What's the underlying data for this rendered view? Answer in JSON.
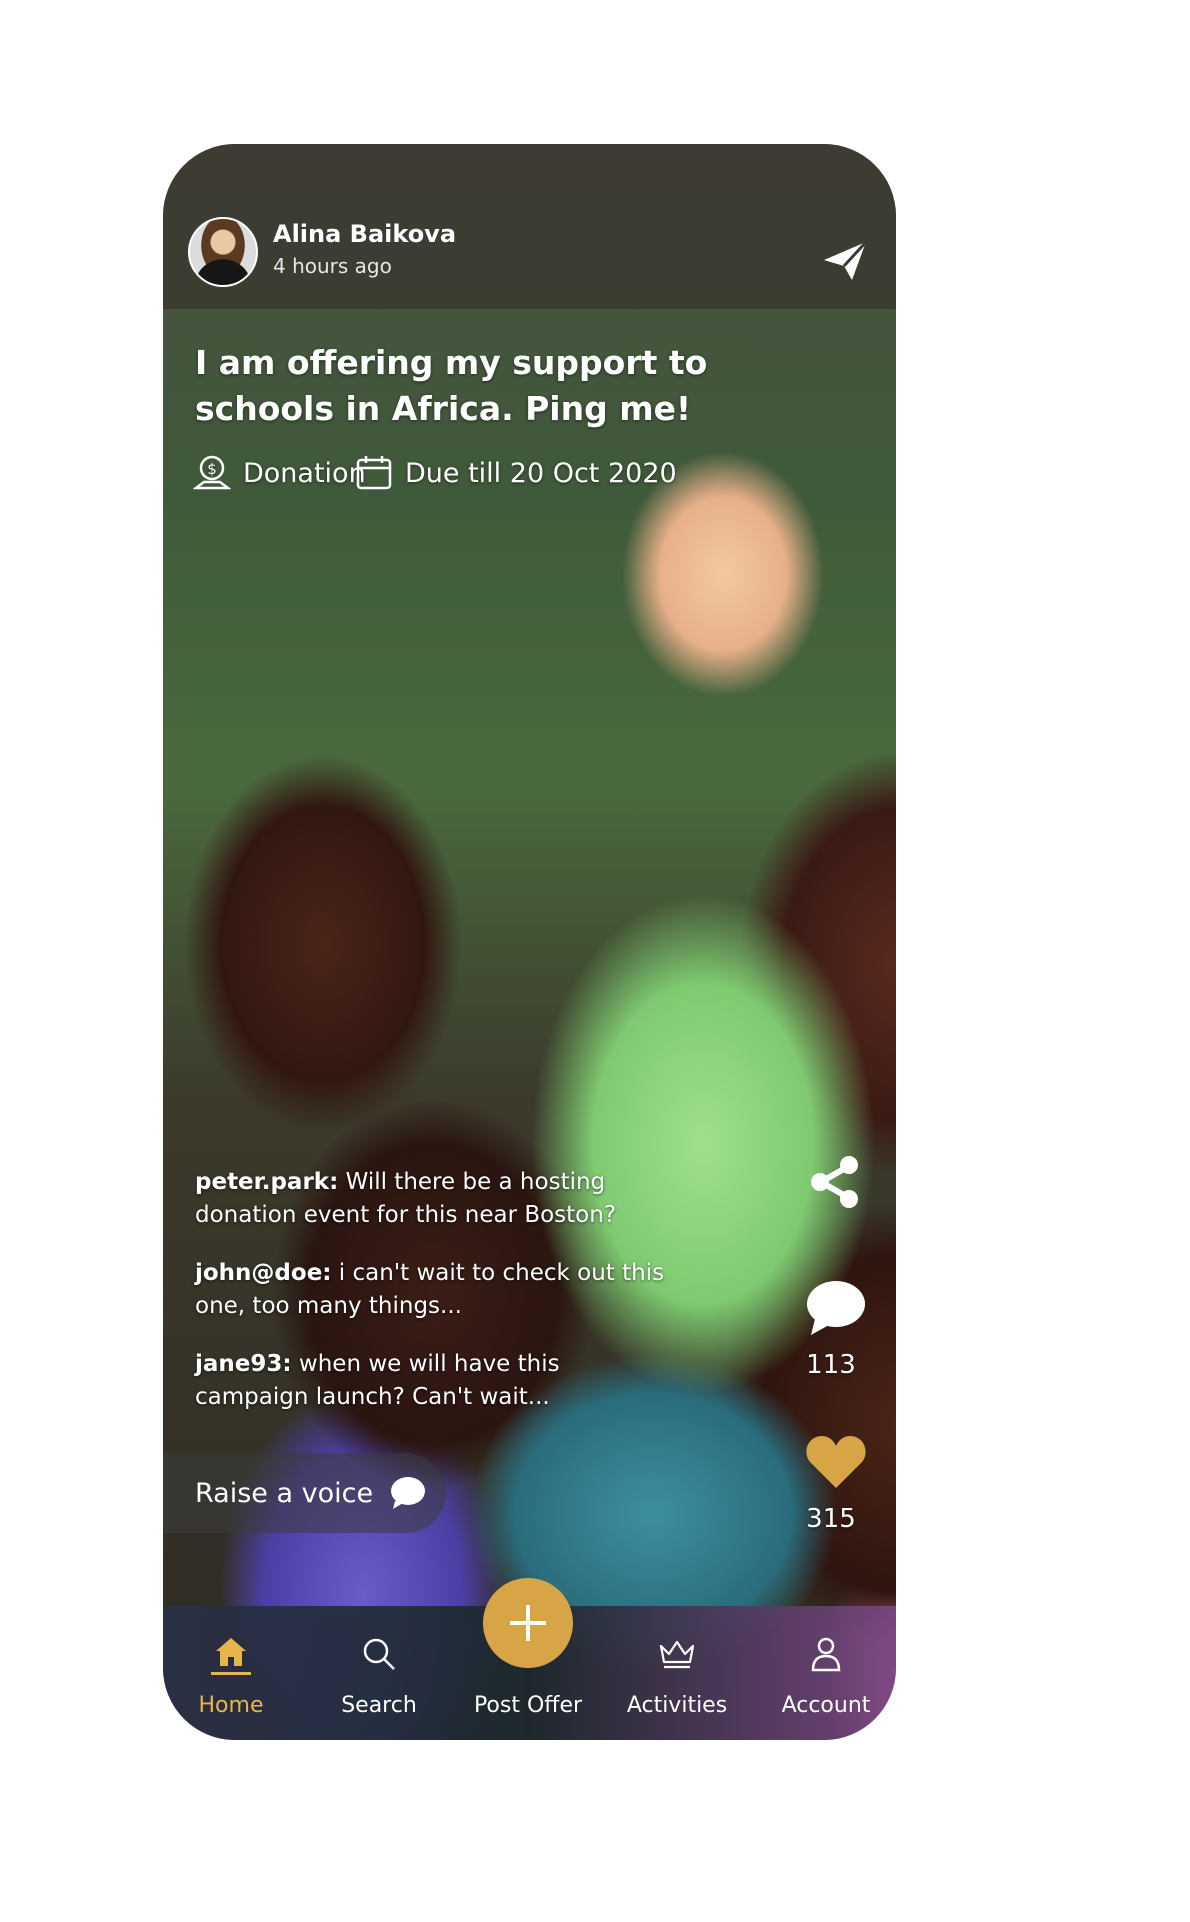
{
  "post": {
    "user_name": "Alina Baikova",
    "time_ago": "4 hours ago",
    "headline": "I am offering my support to schools in Africa. Ping me!",
    "category": "Donation",
    "due": "Due till 20 Oct 2020"
  },
  "comments": [
    {
      "user": "peter.park:",
      "text": " Will there be a hosting donation event for this near Boston?"
    },
    {
      "user": "john@doe:",
      "text": " i can't wait to check out this one, too many things..."
    },
    {
      "user": "jane93:",
      "text": " when we will have this campaign launch? Can't wait..."
    }
  ],
  "raise_voice": "Raise a voice",
  "stats": {
    "comments": "113",
    "likes": "315"
  },
  "nav": {
    "home": "Home",
    "search": "Search",
    "post_offer": "Post Offer",
    "activities": "Activities",
    "account": "Account"
  },
  "colors": {
    "accent": "#d8a546",
    "active_nav": "#e8b54a"
  },
  "icons": [
    "send-icon",
    "donation-icon",
    "calendar-icon",
    "chat-bubble-icon",
    "share-icon",
    "comment-icon",
    "heart-icon",
    "home-icon",
    "search-icon",
    "plus-icon",
    "crown-icon",
    "user-icon"
  ]
}
